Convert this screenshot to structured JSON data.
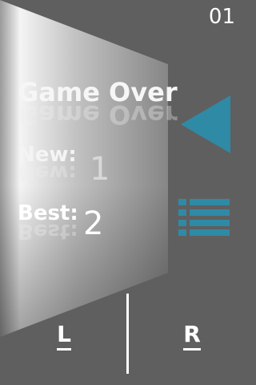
{
  "score_counter": "01",
  "game_over": {
    "title": "Game Over",
    "new_label": "New:",
    "new_value": "1",
    "best_label": "Best:",
    "best_value": "2"
  },
  "icons": {
    "back": "play-back-triangle-icon",
    "menu": "list-menu-icon"
  },
  "controls": {
    "left_label": "L",
    "right_label": "R"
  },
  "colors": {
    "background": "#5f5f5f",
    "accent": "#2f8aa6",
    "text": "#ffffff"
  }
}
